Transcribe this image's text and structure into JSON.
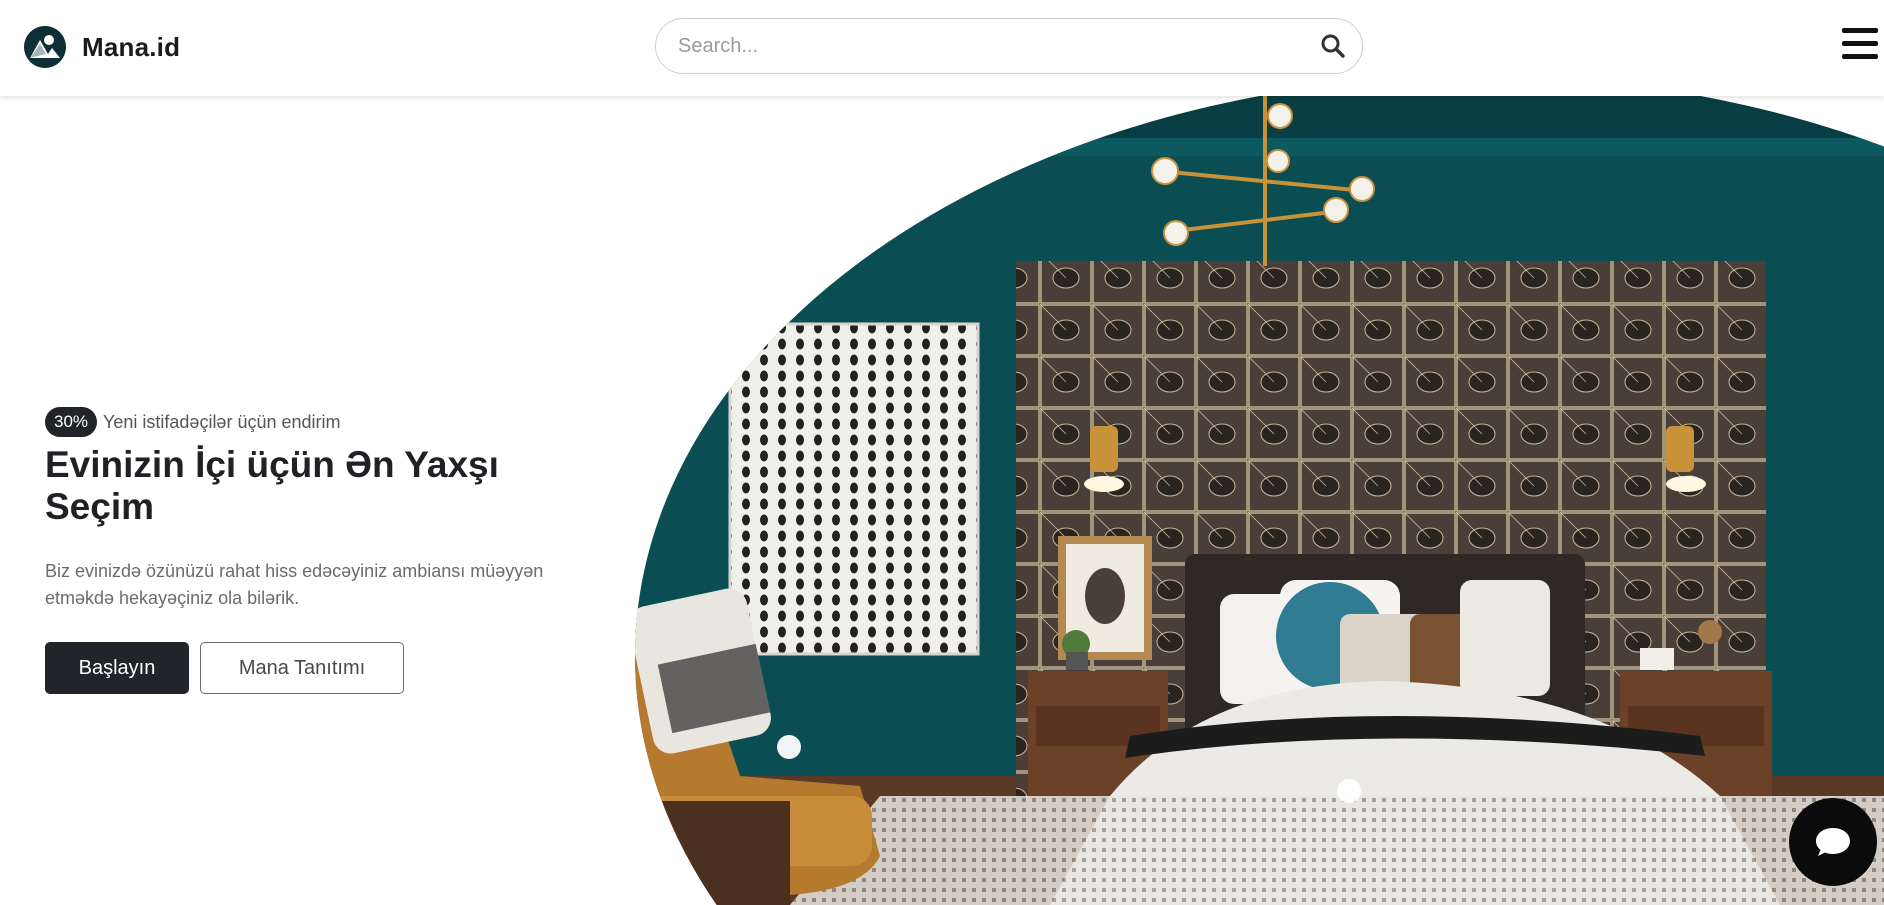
{
  "header": {
    "brand_name": "Mana.id",
    "logo_icon": "mountain-sun-logo-icon",
    "search_placeholder": "Search...",
    "search_icon": "search-icon",
    "menu_icon": "hamburger-menu-icon"
  },
  "hero": {
    "badge": "30%",
    "badge_text": "Yeni istifadəçilər üçün endirim",
    "title": "Evinizin İçi üçün Ən Yaxşı Seçim",
    "description": "Biz evinizdə özünüzü rahat hiss edəcəyiniz ambiansı müəyyən etməkdə hekayəçiniz ola bilərik.",
    "primary_button": "Başlayın",
    "secondary_button": "Mana Tanıtımı"
  },
  "chat": {
    "icon": "chat-bubble-icon"
  },
  "colors": {
    "dark": "#212529",
    "wall_teal": "#0a4e53",
    "accent_gold": "#c8923a"
  }
}
